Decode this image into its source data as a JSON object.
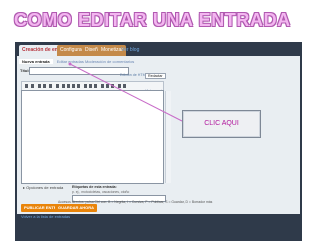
{
  "slide": {
    "title": "COMO EDITAR UNA ENTRADA"
  },
  "tabs": [
    {
      "label": "Creación de entrada"
    },
    {
      "label": "Configuración"
    },
    {
      "label": "Diseño"
    },
    {
      "label": "Monetizar"
    },
    {
      "label": "Ver blog"
    }
  ],
  "editor": {
    "subnav_current": "Nueva entrada",
    "subnav_links": "Editar entradas  Moderación de comentarios",
    "title_label": "Título:",
    "edit_html": "Edición de HTML",
    "compose": "Redactar",
    "preview": "Vista previa",
    "labels_label": "Opciones de entrada",
    "labels_title": "Etiquetas de esta entrada:",
    "labels_example": "p. ej., motocicletas, vacaciones, otoño",
    "shortcuts": "Accesos directos: pulsa Ctrl con: B = Negrita, I = Cursiva, P = Publicar, S = Guardar, D = Borrador más",
    "publish_button": "PUBLICAR ENTRADA",
    "save_button": "GUARDAR AHORA",
    "back_link": "Volver a la lista de entradas"
  },
  "callout": {
    "text": "CLIC AQUI"
  },
  "colors": {
    "accent": "#e9840a",
    "callout_text": "#b1179d",
    "frame": "#2f3a4a"
  }
}
